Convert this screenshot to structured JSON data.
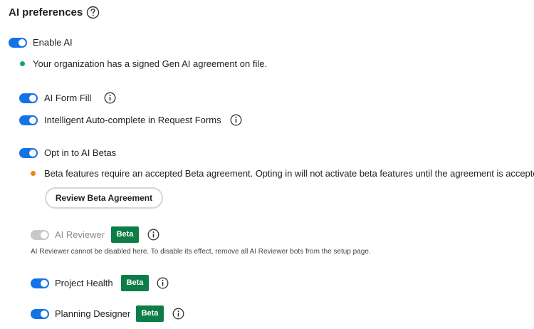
{
  "header": {
    "title": "AI preferences",
    "help_icon": "help-circle-icon"
  },
  "enable_ai": {
    "label": "Enable AI",
    "enabled": true
  },
  "org_status": {
    "text": "Your organization has a signed Gen AI agreement on file.",
    "dot_color": "#12a27a"
  },
  "ai_form_fill": {
    "label": "AI Form Fill",
    "enabled": true,
    "icon": "info-icon"
  },
  "auto_complete": {
    "label": "Intelligent Auto-complete in Request Forms",
    "enabled": true,
    "icon": "info-icon"
  },
  "ai_betas": {
    "label": "Opt in to AI Betas",
    "enabled": true,
    "warning_text": "Beta features require an accepted Beta agreement. Opting in will not activate beta features until the agreement is accepted.",
    "warning_dot_color": "#e68619",
    "review_button": "Review Beta Agreement"
  },
  "ai_reviewer": {
    "label": "AI Reviewer",
    "enabled": true,
    "disabled": true,
    "badge": "Beta",
    "note": "AI Reviewer cannot be disabled here. To disable its effect, remove all AI Reviewer bots from the setup page."
  },
  "project_health": {
    "label": "Project Health",
    "enabled": true,
    "badge": "Beta"
  },
  "planning_designer": {
    "label": "Planning Designer",
    "enabled": true,
    "badge": "Beta"
  },
  "colors": {
    "toggle_on": "#1473e6",
    "toggle_disabled": "#c8c8c8",
    "beta_badge": "#0d7d47"
  }
}
